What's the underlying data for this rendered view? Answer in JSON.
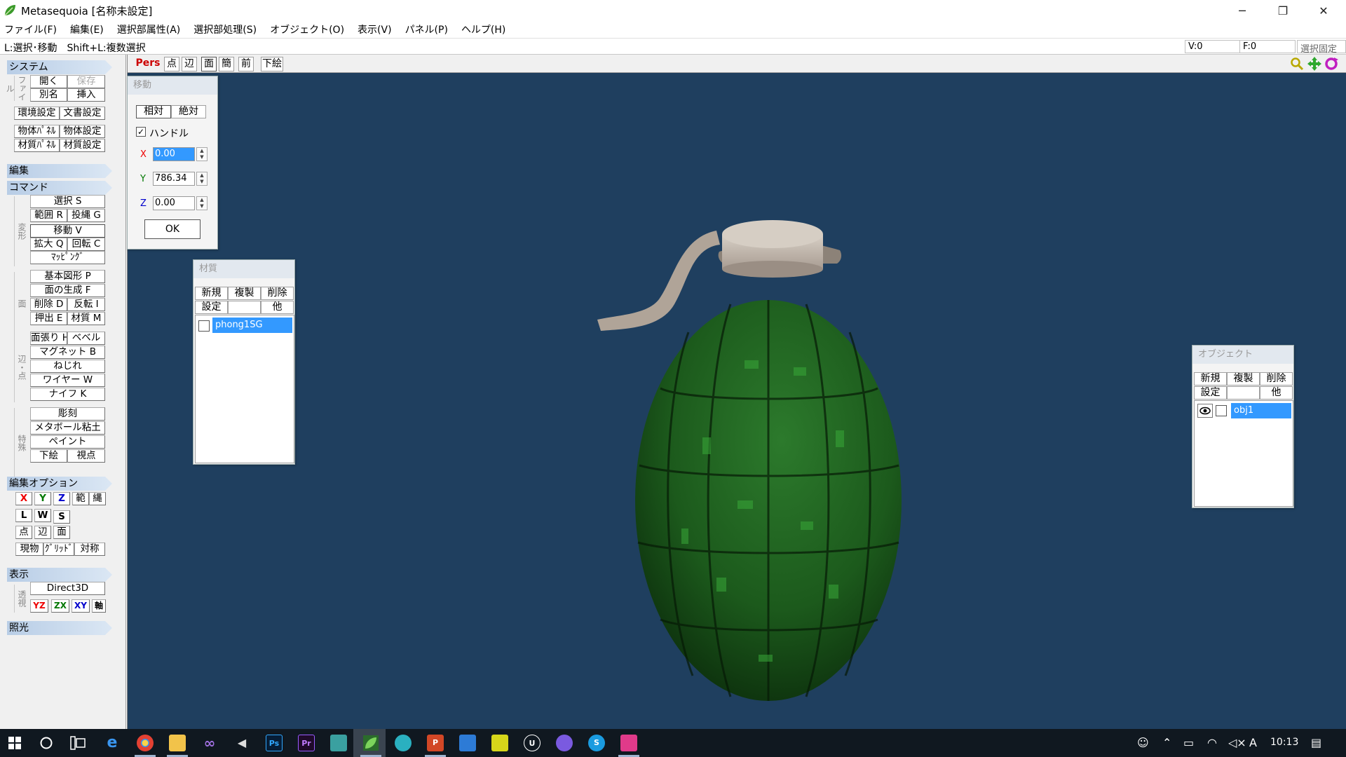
{
  "window": {
    "title": "Metasequoia [名称未設定]",
    "controls": [
      "─",
      "❐",
      "✕"
    ]
  },
  "menubar": [
    "ファイル(F)",
    "編集(E)",
    "選択部属性(A)",
    "選択部処理(S)",
    "オブジェクト(O)",
    "表示(V)",
    "パネル(P)",
    "ヘルプ(H)"
  ],
  "hint": "L:選択･移動　Shift+L:複数選択",
  "status": {
    "v": "V:0",
    "f": "F:0",
    "lock": "選択固定"
  },
  "left": {
    "sections": {
      "system": "システム",
      "edit": "編集",
      "command": "コマンド",
      "edit_option": "編集オプション",
      "display": "表示",
      "lighting": "照光"
    },
    "vlabels": {
      "file": "ファイル",
      "transform": "変形",
      "face": "面",
      "edge_point": "辺・点",
      "special": "特殊",
      "view": "透視"
    },
    "system": {
      "open": "開く",
      "save": "保存",
      "rename": "別名",
      "insert": "挿入",
      "env": "環境設定",
      "doc": "文書設定",
      "objpanel": "物体ﾊﾟﾈﾙ",
      "objset": "物体設定",
      "matpanel": "材質ﾊﾟﾈﾙ",
      "matset": "材質設定"
    },
    "cmd": {
      "select": "選択 S",
      "range": "範囲 R",
      "lasso": "投縄 G",
      "move": "移動 V",
      "scale": "拡大 Q",
      "rotate": "回転 C",
      "mapping": "ﾏｯﾋﾟﾝｸﾞ",
      "primitive": "基本図形 P",
      "genface": "面の生成 F",
      "delete": "削除 D",
      "flip": "反転 I",
      "extrude": "押出 E",
      "material": "材質 M",
      "facet": "面張り H",
      "bevel": "ベベル",
      "magnet": "マグネット B",
      "twist": "ねじれ",
      "wire": "ワイヤー W",
      "knife": "ナイフ K",
      "sculpt": "彫刻",
      "metaball": "メタボール粘土",
      "paint": "ペイント",
      "underlay": "下絵",
      "viewpoint": "視点"
    },
    "opt": {
      "x": "X",
      "y": "Y",
      "z": "Z",
      "range": "範",
      "lasso": "縄",
      "l": "L",
      "w": "W",
      "s": "S",
      "pt": "点",
      "edge": "辺",
      "face": "面",
      "cur": "現物",
      "grid": "ｸﾞﾘｯﾄﾞ",
      "sym": "対称"
    },
    "disp": {
      "d3d": "Direct3D",
      "yz": "YZ",
      "zx": "ZX",
      "xy": "XY",
      "axis": "軸"
    }
  },
  "viewbar": {
    "pers": "Pers",
    "pt": "点",
    "edge": "辺",
    "face": "面",
    "simple": "簡",
    "front": "前",
    "under": "下絵"
  },
  "move_panel": {
    "title": "移動",
    "relative": "相対",
    "absolute": "絶対",
    "handle": "ハンドル",
    "x_label": "X",
    "y_label": "Y",
    "z_label": "Z",
    "x": "0.00",
    "y": "786.34",
    "z": "0.00",
    "ok": "OK",
    "spin_up": "▲",
    "spin_down": "▼"
  },
  "material_panel": {
    "title": "材質",
    "new": "新規",
    "dup": "複製",
    "del": "削除",
    "settings": "設定",
    "other": "他",
    "items": [
      {
        "name": "phong1SG"
      }
    ]
  },
  "object_panel": {
    "title": "オブジェクト",
    "new": "新規",
    "dup": "複製",
    "del": "削除",
    "settings": "設定",
    "other": "他",
    "items": [
      {
        "name": "obj1"
      }
    ]
  },
  "taskbar": {
    "time": "10:13",
    "ime": "A"
  },
  "colors": {
    "viewport": "#1f3f5f",
    "selection": "#3399ff",
    "grenade": "#1e5a1e",
    "cap": "#c8bfb5"
  }
}
